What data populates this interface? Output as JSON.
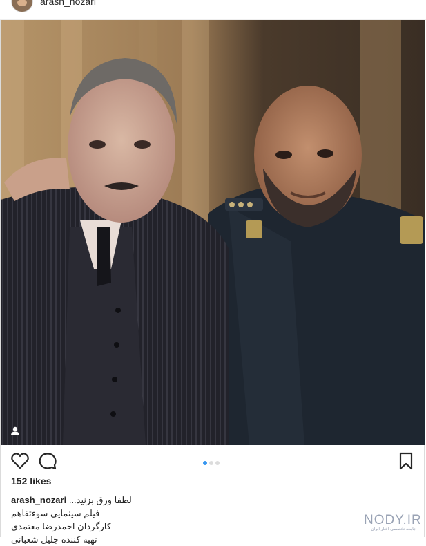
{
  "post": {
    "username": "arash_nozari",
    "likes": "152 likes",
    "caption_user": "arash_nozari",
    "caption_lines": [
      "لطفا ورق بزنید...",
      "فیلم سینمایی سوءتفاهم",
      "کارگردان احمدرضا معتمدی",
      "تهیه کننده جلیل شعبانی"
    ],
    "carousel": {
      "total": 3,
      "active": 1
    }
  },
  "icons": {
    "like": "heart-icon",
    "comment": "comment-bubble-icon",
    "save": "bookmark-icon",
    "tag": "person-tag-icon"
  },
  "watermark": {
    "main": "NODY.IR",
    "sub": "جامعه تخصصی اخبار ایران"
  },
  "colors": {
    "text": "#262626",
    "carousel_active": "#3897f0",
    "border": "#dbdbdb"
  }
}
